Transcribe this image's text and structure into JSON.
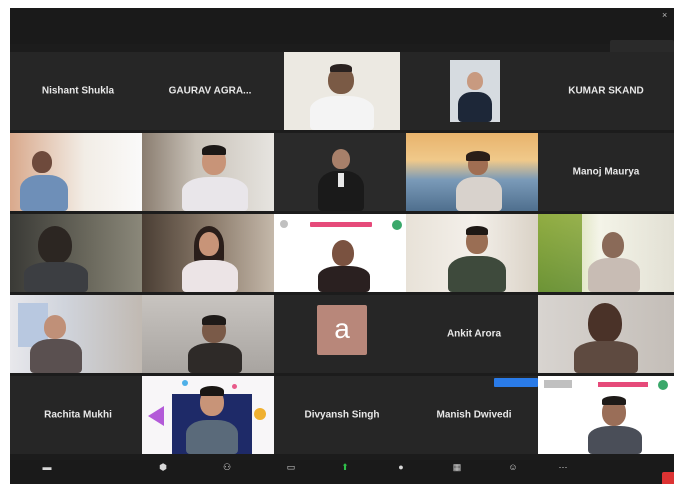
{
  "window": {
    "close_glyph": "×"
  },
  "notification": {
    "text": ""
  },
  "tiles": [
    {
      "id": "r1c1",
      "kind": "name",
      "name": "Nishant Shukla"
    },
    {
      "id": "r1c2",
      "kind": "name",
      "name": "GAURAV AGRA..."
    },
    {
      "id": "r1c3",
      "kind": "video",
      "label": ""
    },
    {
      "id": "r1c4",
      "kind": "video",
      "label": ""
    },
    {
      "id": "r1c5",
      "kind": "name",
      "name": "KUMAR SKAND"
    },
    {
      "id": "r2c1",
      "kind": "video",
      "label": ""
    },
    {
      "id": "r2c2",
      "kind": "video",
      "label": ""
    },
    {
      "id": "r2c3",
      "kind": "video",
      "label": ""
    },
    {
      "id": "r2c4",
      "kind": "video",
      "label": ""
    },
    {
      "id": "r2c5",
      "kind": "name",
      "name": "Manoj Maurya"
    },
    {
      "id": "r3c1",
      "kind": "video",
      "label": ""
    },
    {
      "id": "r3c2",
      "kind": "video",
      "label": ""
    },
    {
      "id": "r3c3",
      "kind": "video",
      "label": "",
      "active": true
    },
    {
      "id": "r3c4",
      "kind": "video",
      "label": ""
    },
    {
      "id": "r3c5",
      "kind": "video",
      "label": ""
    },
    {
      "id": "r4c1",
      "kind": "video",
      "label": ""
    },
    {
      "id": "r4c2",
      "kind": "video",
      "label": ""
    },
    {
      "id": "r4c3",
      "kind": "avatar",
      "letter": "a",
      "label": ""
    },
    {
      "id": "r4c4",
      "kind": "name",
      "name": "Ankit Arora"
    },
    {
      "id": "r4c5",
      "kind": "video",
      "label": ""
    },
    {
      "id": "r5c1",
      "kind": "name",
      "name": "Rachita Mukhi"
    },
    {
      "id": "r5c2",
      "kind": "video",
      "label": ""
    },
    {
      "id": "r5c3",
      "kind": "name",
      "name": "Divyansh Singh"
    },
    {
      "id": "r5c4",
      "kind": "name",
      "name": "Manish Dwivedi"
    },
    {
      "id": "r5c5",
      "kind": "video",
      "label": ""
    }
  ],
  "toolbar": {
    "items": [
      {
        "icon": "video-camera-icon",
        "glyph": "▬",
        "label": ""
      },
      {
        "icon": "security-icon",
        "glyph": "⬢",
        "label": ""
      },
      {
        "icon": "participants-icon",
        "glyph": "⚇",
        "label": ""
      },
      {
        "icon": "chat-icon",
        "glyph": "▭",
        "label": ""
      },
      {
        "icon": "share-screen-icon",
        "glyph": "⬆",
        "label": ""
      },
      {
        "icon": "record-icon",
        "glyph": "●",
        "label": ""
      },
      {
        "icon": "breakout-rooms-icon",
        "glyph": "▦",
        "label": ""
      },
      {
        "icon": "reactions-icon",
        "glyph": "☺",
        "label": ""
      },
      {
        "icon": "more-icon",
        "glyph": "⋯",
        "label": ""
      }
    ]
  }
}
